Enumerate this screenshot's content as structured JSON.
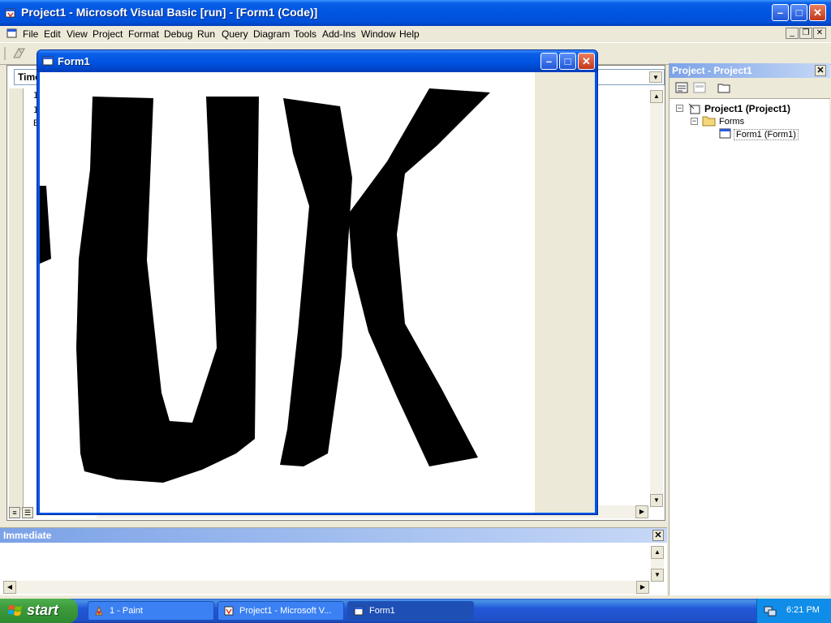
{
  "window": {
    "title": "Project1 - Microsoft Visual Basic [run] - [Form1 (Code)]",
    "minimize": "–",
    "maximize": "□",
    "close": "✕"
  },
  "menu": {
    "items": [
      "File",
      "Edit",
      "View",
      "Project",
      "Format",
      "Debug",
      "Run",
      "Query",
      "Diagram",
      "Tools",
      "Add-Ins",
      "Window",
      "Help"
    ]
  },
  "code_window": {
    "object_combo": "Timer",
    "lines": [
      "I",
      "I",
      "E"
    ]
  },
  "form1": {
    "title": "Form1",
    "drawing_text": "UK"
  },
  "project_explorer": {
    "title": "Project - Project1",
    "tree": {
      "project": "Project1 (Project1)",
      "folder": "Forms",
      "form": "Form1 (Form1)"
    }
  },
  "immediate": {
    "title": "Immediate"
  },
  "taskbar": {
    "start_label": "start",
    "tasks": [
      "1 - Paint",
      "Project1 - Microsoft V...",
      "Form1"
    ],
    "clock": "6:21 PM"
  },
  "colors": {
    "xp_blue": "#0054e3",
    "taskbar_blue": "#2157d7",
    "start_green": "#3c9a3c",
    "tray_blue": "#0f8de8"
  }
}
